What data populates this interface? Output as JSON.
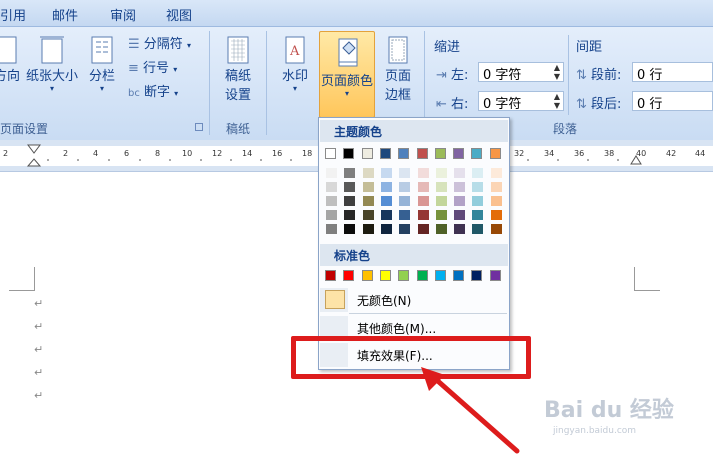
{
  "menu": {
    "tabs": [
      "引用",
      "邮件",
      "审阅",
      "视图"
    ]
  },
  "ribbon": {
    "page_setup": {
      "label": "页面设置",
      "orientation_label": "方向",
      "size_label": "纸张大小",
      "columns_label": "分栏",
      "breaks_label": "分隔符",
      "line_numbers_label": "行号",
      "hyphenation_label": "断字"
    },
    "draft": {
      "label": "稿纸",
      "button_label_1": "稿纸",
      "button_label_2": "设置"
    },
    "background": {
      "watermark_label": "水印",
      "page_color_label": "页面颜色",
      "page_border_label_1": "页面",
      "page_border_label_2": "边框"
    },
    "paragraph": {
      "label": "段落",
      "indent_label": "缩进",
      "spacing_label": "间距",
      "left_label": "左:",
      "right_label": "右:",
      "before_label": "段前:",
      "after_label": "段后:",
      "left_value": "0 字符",
      "right_value": "0 字符",
      "before_value": "0 行",
      "after_value": "0 行"
    }
  },
  "ruler": {
    "ticks": [
      "2",
      "2",
      "4",
      "6",
      "8",
      "10",
      "12",
      "14",
      "16",
      "18",
      "32",
      "34",
      "36",
      "38",
      "40",
      "42",
      "44"
    ]
  },
  "dropdown": {
    "theme_colors_title": "主题颜色",
    "standard_colors_title": "标准色",
    "no_color_label": "无颜色(N)",
    "more_colors_label": "其他颜色(M)...",
    "fill_effects_label": "填充效果(F)...",
    "theme_colors": [
      "#ffffff",
      "#000000",
      "#eeece1",
      "#1f497d",
      "#4f81bd",
      "#c0504d",
      "#9bbb59",
      "#8064a2",
      "#4bacc6",
      "#f79646"
    ],
    "theme_shades": [
      [
        "#f2f2f2",
        "#d8d8d8",
        "#bfbfbf",
        "#a5a5a5",
        "#7f7f7f"
      ],
      [
        "#7f7f7f",
        "#595959",
        "#3f3f3f",
        "#262626",
        "#0c0c0c"
      ],
      [
        "#ddd9c3",
        "#c4bd97",
        "#938953",
        "#494429",
        "#1d1b10"
      ],
      [
        "#c6d9f0",
        "#8db3e2",
        "#548dd4",
        "#17365d",
        "#0f243e"
      ],
      [
        "#dbe5f1",
        "#b8cce4",
        "#95b3d7",
        "#366092",
        "#244061"
      ],
      [
        "#f2dcdb",
        "#e5b9b7",
        "#d99694",
        "#953734",
        "#632423"
      ],
      [
        "#ebf1dd",
        "#d7e3bc",
        "#c3d69b",
        "#76923c",
        "#4f6128"
      ],
      [
        "#e5e0ec",
        "#ccc1d9",
        "#b2a2c7",
        "#5f497a",
        "#3f3151"
      ],
      [
        "#dbeef3",
        "#b7dde8",
        "#92cddc",
        "#31859b",
        "#205867"
      ],
      [
        "#fdeada",
        "#fbd5b5",
        "#fac08f",
        "#e36c09",
        "#974806"
      ]
    ],
    "standard_colors": [
      "#c00000",
      "#ff0000",
      "#ffc000",
      "#ffff00",
      "#92d050",
      "#00b050",
      "#00b0f0",
      "#0070c0",
      "#002060",
      "#7030a0"
    ],
    "no_color_swatch": "#fde3a7"
  },
  "colors": {
    "highlight": "#dd1c1c",
    "accent": "#15428b"
  },
  "watermark": {
    "logo_text": "Bai du 经验",
    "url": "jingyan.baidu.com"
  }
}
